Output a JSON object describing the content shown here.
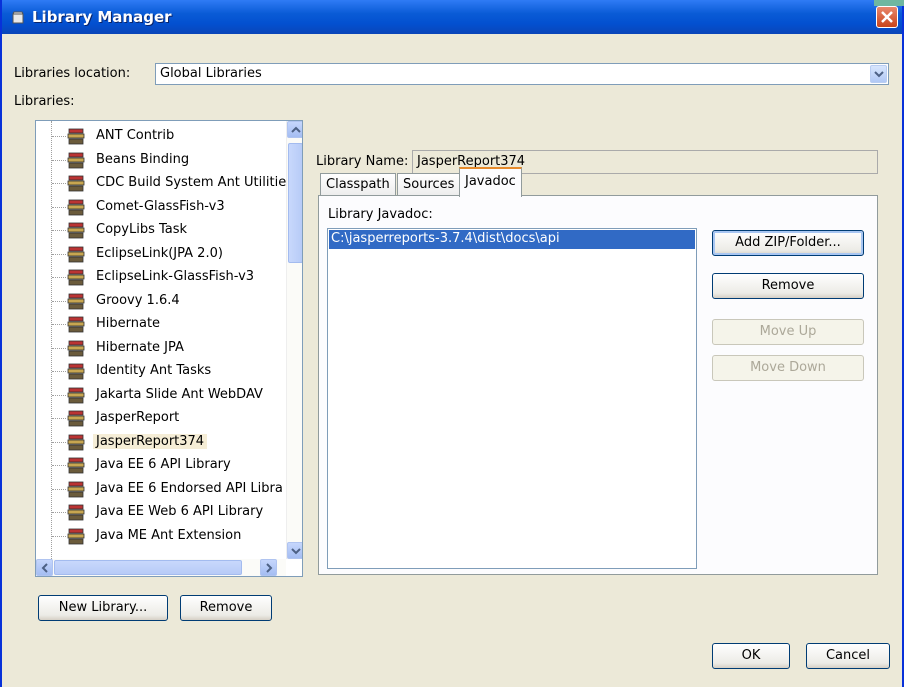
{
  "window": {
    "title": "Library Manager"
  },
  "location": {
    "label": "Libraries location:",
    "value": "Global Libraries"
  },
  "libraries": {
    "label": "Libraries:",
    "items": [
      "ANT Contrib",
      "Beans Binding",
      "CDC Build System Ant Utilities",
      "Comet-GlassFish-v3",
      "CopyLibs Task",
      "EclipseLink(JPA 2.0)",
      "EclipseLink-GlassFish-v3",
      "Groovy 1.6.4",
      "Hibernate",
      "Hibernate JPA",
      "Identity Ant Tasks",
      "Jakarta Slide Ant WebDAV",
      "JasperReport",
      "JasperReport374",
      "Java EE 6 API Library",
      "Java EE 6 Endorsed API Libra",
      "Java EE Web 6 API Library",
      "Java ME Ant Extension"
    ],
    "selected": "JasperReport374"
  },
  "library_name": {
    "label": "Library Name:",
    "value": "JasperReport374"
  },
  "tabs": [
    {
      "label": "Classpath"
    },
    {
      "label": "Sources"
    },
    {
      "label": "Javadoc",
      "active": true
    }
  ],
  "javadoc": {
    "label": "Library Javadoc:",
    "entries": [
      "C:\\jasperreports-3.7.4\\dist\\docs\\api"
    ]
  },
  "buttons": {
    "add_zip_folder": "Add ZIP/Folder...",
    "remove": "Remove",
    "move_up": "Move Up",
    "move_down": "Move Down",
    "new_library": "New Library...",
    "remove_library": "Remove",
    "ok": "OK",
    "cancel": "Cancel"
  },
  "colors": {
    "title_bar": "#0350d0",
    "selection": "#316ac5",
    "tab_accent": "#e68b2c"
  },
  "icons": [
    "library-icon",
    "close-icon",
    "chevron-down-icon",
    "scroll-up-icon",
    "scroll-down-icon",
    "scroll-left-icon",
    "scroll-right-icon"
  ]
}
